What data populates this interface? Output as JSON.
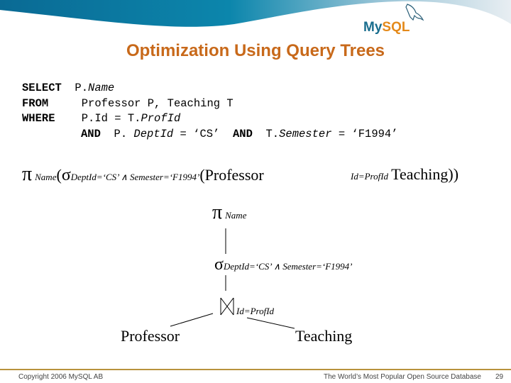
{
  "brand": {
    "logo_my": "My",
    "logo_sql": "SQL",
    "logo_icon": "dolphin-icon",
    "colors": {
      "accent_orange": "#c8691a",
      "logo_blue": "#1a6e8e",
      "header_blue": "#0e7fa6",
      "footer_rule": "#b8923c"
    }
  },
  "slide": {
    "title": "Optimization Using Query Trees",
    "sql": {
      "select_kw": "SELECT",
      "select_prefix": "P.",
      "select_field": "Name",
      "from_kw": "FROM",
      "from_text": "Professor P, Teaching T",
      "where_kw": "WHERE",
      "where_prefix": "P.Id = T.",
      "where_field": "ProfId",
      "and1_kw": "AND",
      "and1_prefix": "P. ",
      "and1_field": "DeptId",
      "and1_value": " = ‘CS’",
      "and2_kw": "AND",
      "and2_prefix": "T.",
      "and2_field": "Semester",
      "and2_value": " = ‘F1994’"
    },
    "expression": {
      "pi": "π",
      "pi_sub": "Name",
      "open_paren": "(",
      "sigma": "σ",
      "sigma_sub": "DeptId=‘CS’ ∧ Semester=‘F1994’",
      "open_paren2": "(",
      "left_relation": "Professor",
      "join_sub": "Id=ProfId",
      "right_relation": "Teaching",
      "close": "))"
    },
    "tree": {
      "root_symbol": "π",
      "root_sub": "Name",
      "select_symbol": "σ",
      "select_sub": "DeptId=‘CS’ ∧ Semester=‘F1994’",
      "join_icon": "bowtie-join-icon",
      "join_sub": "Id=ProfId",
      "left_leaf": "Professor",
      "right_leaf": "Teaching"
    }
  },
  "footer": {
    "copyright": "Copyright 2006 MySQL AB",
    "tagline": "The World’s Most Popular Open Source Database",
    "page_number": "29"
  }
}
